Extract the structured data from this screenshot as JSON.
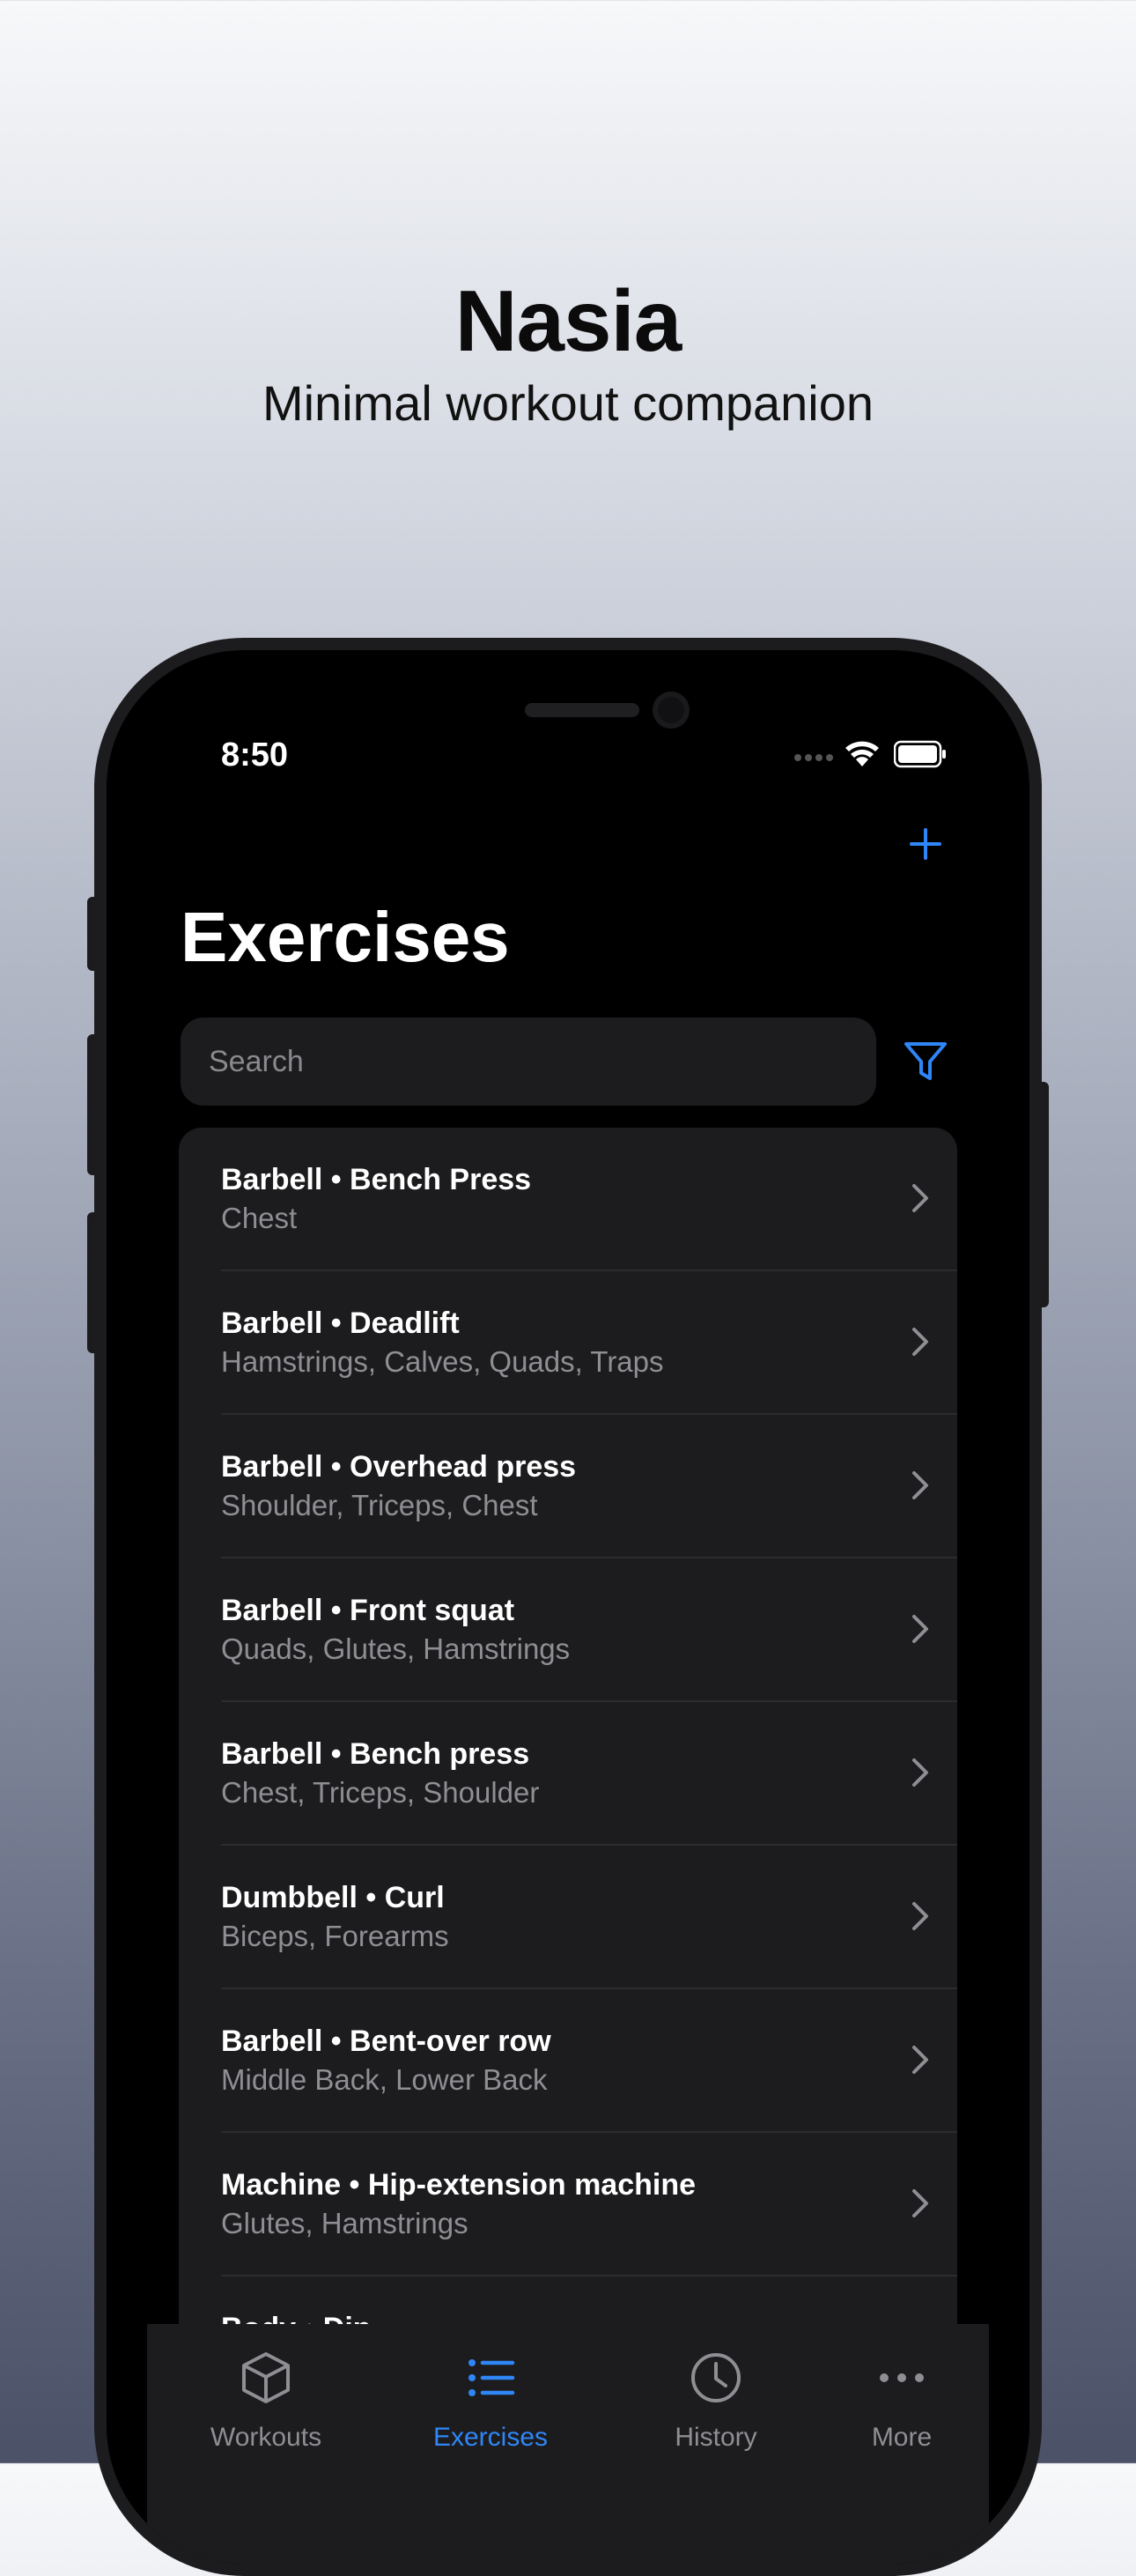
{
  "hero": {
    "title": "Nasia",
    "subtitle": "Minimal workout companion"
  },
  "status_bar": {
    "time": "8:50",
    "icons": [
      "signal-icon",
      "wifi-icon",
      "battery-icon"
    ]
  },
  "nav": {
    "add_icon": "plus-icon",
    "title": "Exercises"
  },
  "search": {
    "placeholder": "Search",
    "value": "",
    "filter_icon": "filter-icon"
  },
  "exercises": [
    {
      "title": "Barbell • Bench Press",
      "muscles": "Chest"
    },
    {
      "title": "Barbell • Deadlift",
      "muscles": "Hamstrings, Calves, Quads, Traps"
    },
    {
      "title": "Barbell • Overhead press",
      "muscles": "Shoulder, Triceps, Chest"
    },
    {
      "title": "Barbell • Front squat",
      "muscles": "Quads, Glutes, Hamstrings"
    },
    {
      "title": "Barbell • Bench press",
      "muscles": "Chest, Triceps, Shoulder"
    },
    {
      "title": "Dumbbell • Curl",
      "muscles": "Biceps, Forearms"
    },
    {
      "title": "Barbell • Bent-over row",
      "muscles": "Middle Back, Lower Back"
    },
    {
      "title": "Machine • Hip-extension machine",
      "muscles": "Glutes, Hamstrings"
    },
    {
      "title": "Body • Dip",
      "muscles": ""
    }
  ],
  "tabs": [
    {
      "label": "Workouts",
      "icon": "cube-icon",
      "active": false
    },
    {
      "label": "Exercises",
      "icon": "list-icon",
      "active": true
    },
    {
      "label": "History",
      "icon": "clock-icon",
      "active": false
    },
    {
      "label": "More",
      "icon": "ellipsis-icon",
      "active": false
    }
  ],
  "colors": {
    "accent": "#2f86f6",
    "background": "#000000",
    "card": "#1c1c1e",
    "secondary_text": "#8e8e93"
  }
}
